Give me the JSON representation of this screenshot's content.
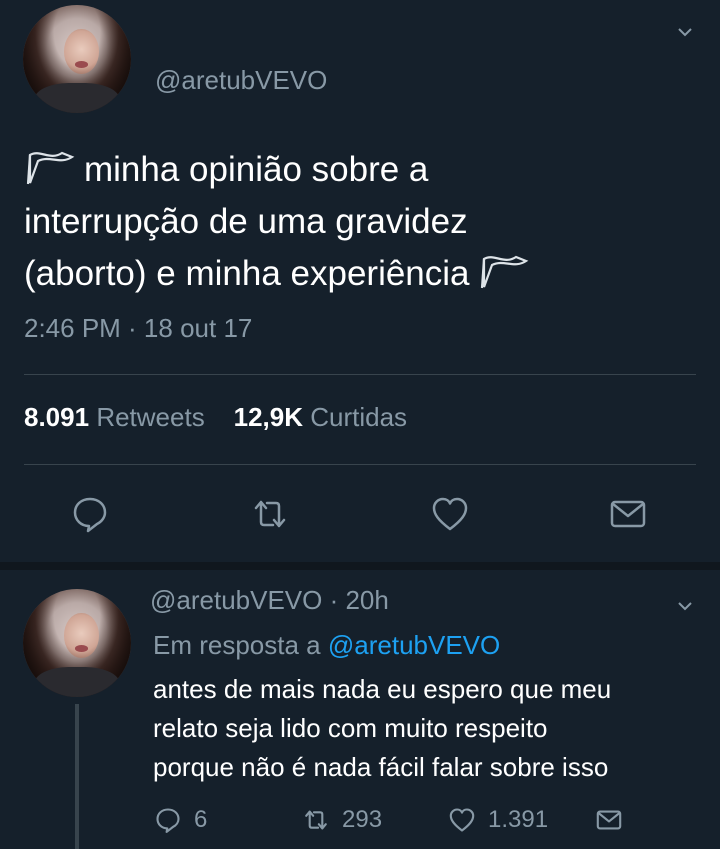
{
  "tweet": {
    "handle": "@aretubVEVO",
    "text_line1": "minha opinião sobre a",
    "text_line2": "interrupção de uma gravidez",
    "text_line3": "(aborto) e minha experiência",
    "timestamp": "2:46 PM · 18 out 17",
    "retweets_count": "8.091",
    "retweets_label": "Retweets",
    "likes_count": "12,9K",
    "likes_label": "Curtidas"
  },
  "reply": {
    "header": "@aretubVEVO · 20h",
    "reply_prefix": "Em resposta a",
    "reply_mention": "@aretubVEVO",
    "text_line1": "antes de mais nada eu espero que meu",
    "text_line2": "relato seja lido com muito respeito",
    "text_line3": "porque não é nada fácil falar sobre isso",
    "replies": "6",
    "retweets": "293",
    "likes": "1.391"
  },
  "colors": {
    "background": "#15202b",
    "secondary_text": "#8899a6",
    "link": "#1da1f2",
    "divider": "#38444d"
  },
  "icons": [
    "avatar",
    "chevron-down-icon",
    "flag-icon",
    "reply-icon",
    "retweet-icon",
    "like-icon",
    "share-icon"
  ]
}
